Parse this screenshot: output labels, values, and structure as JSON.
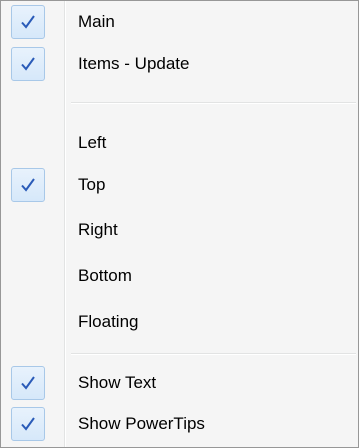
{
  "menu": {
    "items": [
      {
        "label": "Main",
        "checked": true
      },
      {
        "label": "Items - Update",
        "checked": true
      },
      {
        "label": "Left",
        "checked": false
      },
      {
        "label": "Top",
        "checked": true
      },
      {
        "label": "Right",
        "checked": false
      },
      {
        "label": "Bottom",
        "checked": false
      },
      {
        "label": "Floating",
        "checked": false
      },
      {
        "label": "Show Text",
        "checked": true
      },
      {
        "label": "Show PowerTips",
        "checked": true
      }
    ]
  },
  "icons": {
    "check": "checkmark-icon"
  },
  "colors": {
    "check_mark": "#2a5bb8",
    "check_bg": "#dbeafb",
    "check_border": "#a8c8e8",
    "menu_bg": "#f5f5f5",
    "menu_border": "#979797"
  }
}
